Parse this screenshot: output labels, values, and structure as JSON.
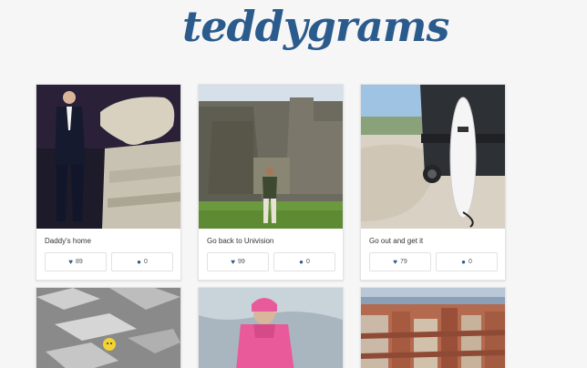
{
  "brand": {
    "logo_text": "teddygrams",
    "accent": "#2a5b8c"
  },
  "posts": [
    {
      "caption": "Daddy's home",
      "likes": "89",
      "comments": "0"
    },
    {
      "caption": "Go back to Univision",
      "likes": "99",
      "comments": "0"
    },
    {
      "caption": "Go out and get it",
      "likes": "79",
      "comments": "0"
    }
  ],
  "icons": {
    "like": "heart-icon",
    "comment": "comment-bubble-icon"
  }
}
